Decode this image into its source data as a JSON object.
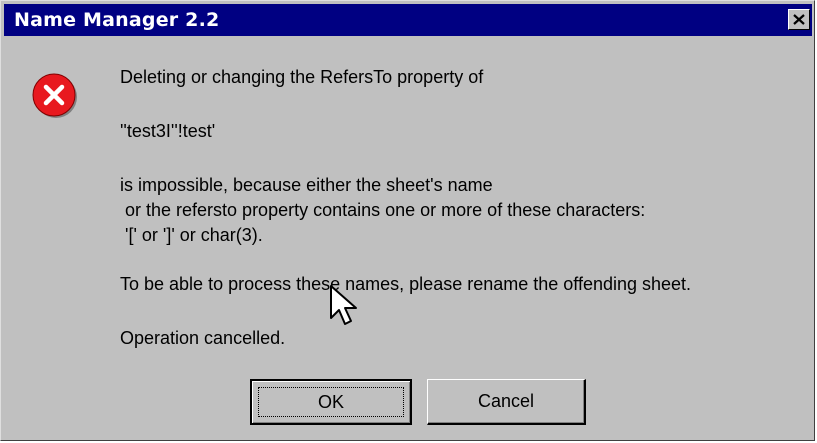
{
  "window": {
    "title": "Name Manager 2.2",
    "close_icon": "close-icon"
  },
  "message": {
    "icon": "error-icon",
    "line1": "Deleting or changing the RefersTo property of",
    "line2": "''test3I''!test'",
    "line3": "is impossible, because either the sheet's name",
    "line4": " or the refersto property contains one or more of these characters:",
    "line5": " '[' or ']' or char(3).",
    "line6": "To be able to process these names, please rename the offending sheet.",
    "line7": "Operation cancelled."
  },
  "buttons": {
    "ok_label": "OK",
    "cancel_label": "Cancel"
  },
  "colors": {
    "titlebar": "#000082",
    "dialog_face": "#c0c0c0",
    "error_red": "#e8191f"
  }
}
